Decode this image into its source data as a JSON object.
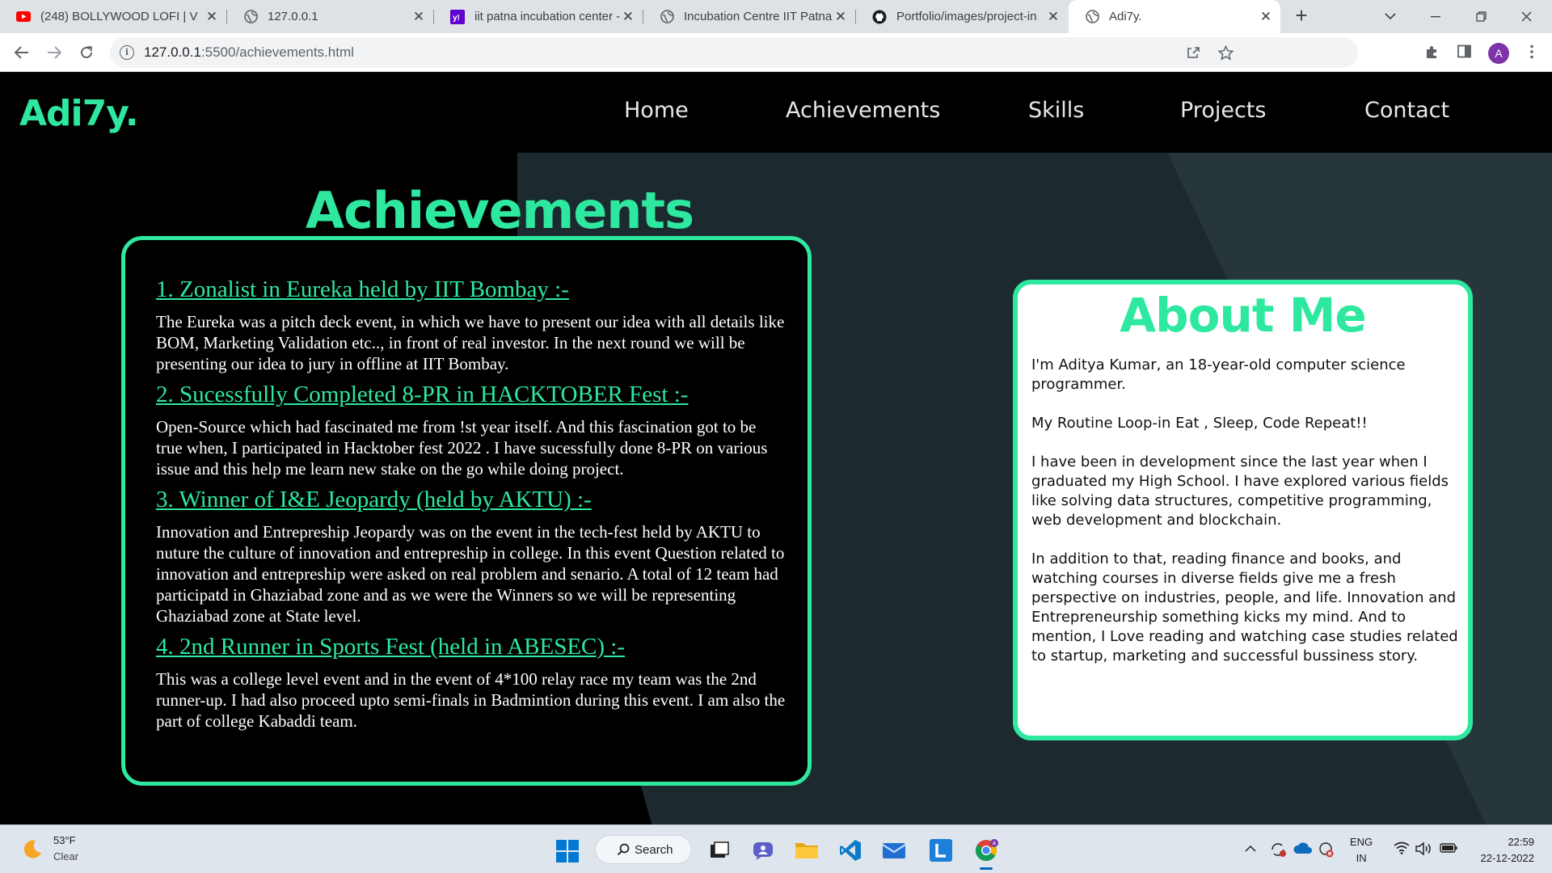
{
  "browser": {
    "tabs": [
      {
        "title": "(248) BOLLYWOOD LOFI | V",
        "icon": "youtube-icon",
        "active": false
      },
      {
        "title": "127.0.0.1",
        "icon": "globe-icon",
        "active": false
      },
      {
        "title": "iit patna incubation center -",
        "icon": "yahoo-icon",
        "active": false
      },
      {
        "title": "Incubation Centre IIT Patna",
        "icon": "globe-icon",
        "active": false
      },
      {
        "title": "Portfolio/images/project-in",
        "icon": "github-icon",
        "active": false
      },
      {
        "title": "Adi7y.",
        "icon": "globe-icon",
        "active": true
      }
    ],
    "new_tab_label": "+",
    "url_host": "127.0.0.1",
    "url_path": ":5500/achievements.html",
    "profile_initial": "A",
    "accent": "#1a73e8"
  },
  "page": {
    "logo": "Adi7y.",
    "nav": [
      "Home",
      "Achievements",
      "Skills",
      "Projects",
      "Contact"
    ],
    "accent": "#2ee8a0",
    "achievements": {
      "title": "Achievements",
      "items": [
        {
          "heading": "1. Zonalist in Eureka held by IIT Bombay :-",
          "body": "The Eureka was a pitch deck event, in which we have to present our idea with all details like BOM, Marketing Validation etc.., in front of real investor. In the next round we will be presenting our idea to jury in offline at IIT Bombay."
        },
        {
          "heading": "2. Sucessfully Completed 8-PR in HACKTOBER Fest :-",
          "body": "Open-Source which had fascinated me from !st year itself. And this fascination got to be true when, I participated in Hacktober fest 2022 . I have sucessfully done 8-PR on various issue and this help me learn new stake on the go while doing project."
        },
        {
          "heading": "3. Winner of I&E Jeopardy (held by AKTU) :-",
          "body": "Innovation and Entrepreship Jeopardy was on the event in the tech-fest held by AKTU to nuture the culture of innovation and entrepreship in college. In this event Question related to innovation and entrepreship were asked on real problem and senario. A total of 12 team had participatd in Ghaziabad zone and as we were the Winners so we will be representing Ghaziabad zone at State level."
        },
        {
          "heading": "4. 2nd Runner in Sports Fest (held in ABESEC) :-",
          "body": "This was a college level event and in the event of 4*100 relay race my team was the 2nd runner-up. I had also proceed upto semi-finals in Badmintion during this event. I am also the part of college Kabaddi team."
        }
      ]
    },
    "about": {
      "title": "About Me",
      "paragraphs": [
        "I'm Aditya Kumar, an 18-year-old computer science programmer.",
        "My Routine Loop-in Eat , Sleep, Code Repeat!!",
        "I have been in development since the last year when I graduated my High School. I have explored various fields like solving data structures, competitive programming, web development and blockchain.",
        "In addition to that, reading finance and books, and watching courses in diverse fields give me a fresh perspective on industries, people, and life. Innovation and Entrepreneurship something kicks my mind. And to mention, I Love reading and watching case studies related to startup, marketing and successful bussiness story."
      ]
    }
  },
  "taskbar": {
    "weather_temp": "53°F",
    "weather_cond": "Clear",
    "search_label": "Search",
    "lang_top": "ENG",
    "lang_bottom": "IN",
    "time": "22:59",
    "date": "22-12-2022",
    "apps": [
      "task-view-icon",
      "chat-icon",
      "file-explorer-icon",
      "vscode-icon",
      "mail-icon",
      "l-app-icon",
      "chrome-icon"
    ]
  }
}
